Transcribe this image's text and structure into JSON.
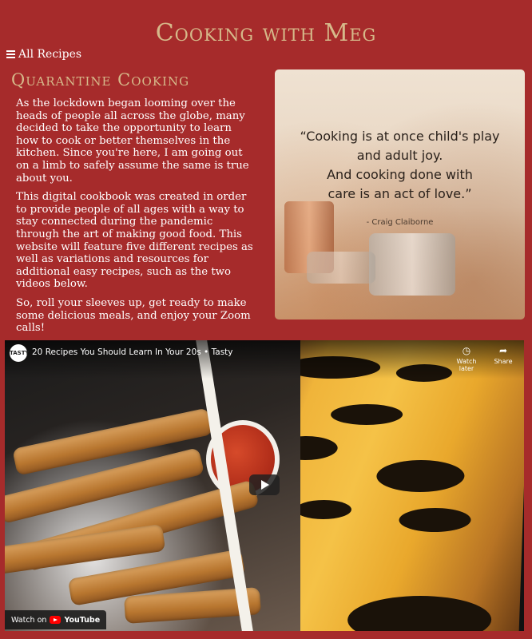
{
  "site": {
    "title": "Cooking with Meg"
  },
  "nav": {
    "label": "All Recipes",
    "icon": "hamburger-menu-icon"
  },
  "section": {
    "title": "Quarantine Cooking",
    "paragraphs": [
      "As the lockdown began looming over the heads of people all across the globe, many decided to take the opportunity to learn how to cook or better themselves in the kitchen. Since you're here, I am going out on a limb to safely assume the same is true about you.",
      "This digital cookbook was created in order to provide people of all ages with a way to stay connected during the pandemic through the art of making good food. This website will feature five different recipes as well as variations and resources for additional easy recipes, such as the two videos below.",
      "So, roll your sleeves up, get ready to make some delicious meals, and enjoy your Zoom calls!"
    ]
  },
  "quote": {
    "lines": [
      "“Cooking is at once child's play",
      "and adult joy.",
      "And cooking done with",
      "care is an act of love.”"
    ],
    "author": "- Craig Claiborne"
  },
  "video": {
    "channel": "TASTY",
    "title": "20 Recipes You Should Learn In Your 20s • Tasty",
    "watch_later": "Watch later",
    "share": "Share",
    "watch_on": "Watch on",
    "youtube": "YouTube"
  },
  "colors": {
    "background": "#a62b2b",
    "accent": "#d6b98a",
    "text": "#ffffff"
  }
}
